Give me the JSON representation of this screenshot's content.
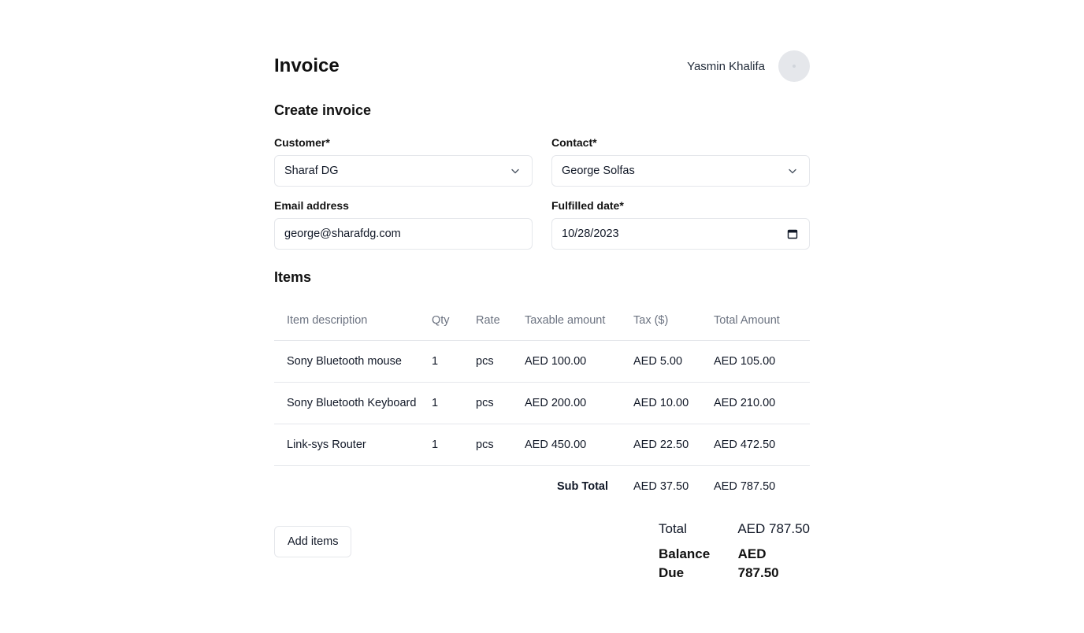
{
  "header": {
    "title": "Invoice",
    "user_name": "Yasmin Khalifa"
  },
  "form": {
    "section_title": "Create invoice",
    "customer": {
      "label": "Customer*",
      "value": "Sharaf DG"
    },
    "contact": {
      "label": "Contact*",
      "value": "George Solfas"
    },
    "email": {
      "label": "Email address",
      "value": "george@sharafdg.com"
    },
    "fulfilled_date": {
      "label": "Fulfilled date*",
      "value": "10/28/2023"
    }
  },
  "items": {
    "section_title": "Items",
    "columns": [
      "Item description",
      "Qty",
      "Rate",
      "Taxable amount",
      "Tax ($)",
      "Total Amount"
    ],
    "rows": [
      [
        "Sony Bluetooth mouse",
        "1",
        "pcs",
        "AED 100.00",
        "AED 5.00",
        "AED 105.00"
      ],
      [
        "Sony Bluetooth Keyboard",
        "1",
        "pcs",
        "AED 200.00",
        "AED 10.00",
        "AED 210.00"
      ],
      [
        "Link-sys Router",
        "1",
        "pcs",
        "AED 450.00",
        "AED 22.50",
        "AED 472.50"
      ]
    ],
    "subtotal": {
      "label": "Sub Total",
      "tax": "AED 37.50",
      "total": "AED 787.50"
    }
  },
  "actions": {
    "add_items_label": "Add items"
  },
  "totals": {
    "total_label": "Total",
    "total_value": "AED 787.50",
    "balance_label": "Balance Due",
    "balance_value": "AED 787.50"
  },
  "icons": {
    "customer_dropdown": "chevron-down-icon",
    "contact_dropdown": "chevron-down-icon",
    "date_picker": "calendar-icon"
  },
  "colors": {
    "border": "#e5e7eb",
    "muted_text": "#6b7280",
    "avatar_bg": "#e5e7eb"
  }
}
